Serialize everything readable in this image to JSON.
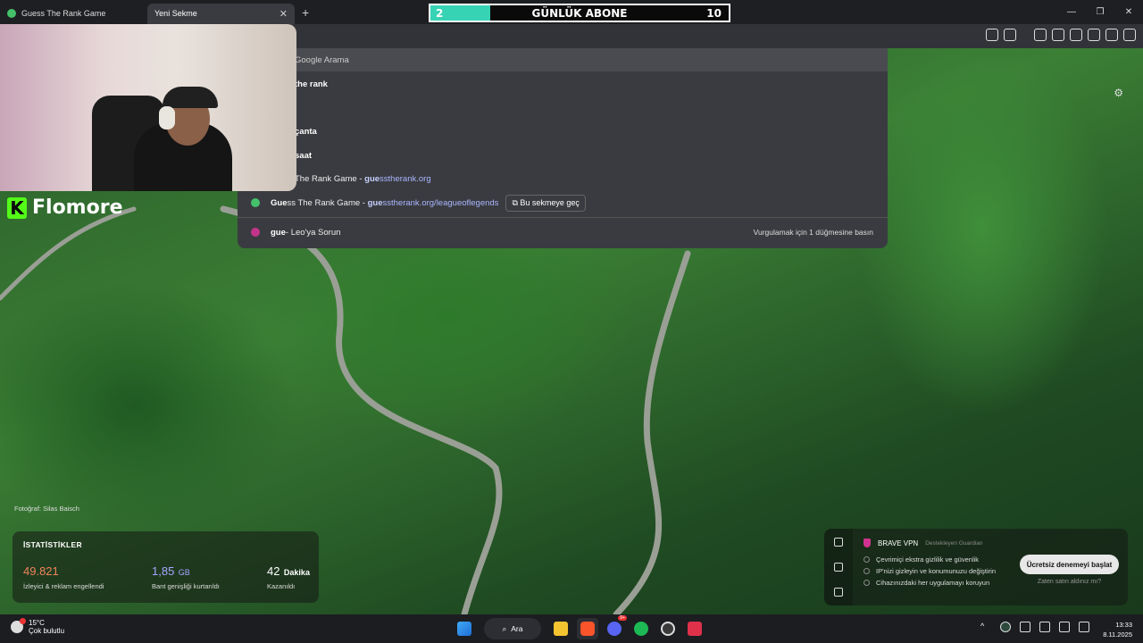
{
  "tabs": [
    {
      "label": "Guess The Rank Game",
      "active": false
    },
    {
      "label": "Yeni Sekme",
      "active": true
    }
  ],
  "subscriber_goal": {
    "title": "GÜNLÜK ABONE",
    "current": "2",
    "target": "10",
    "progress": 0.2,
    "bar_color": "#37d3b5"
  },
  "streamer_brand": {
    "name": "Flomore",
    "logo_letter": "K",
    "logo_color": "#53fc18"
  },
  "omnibox": {
    "suggestions": [
      {
        "text": "Google Arama",
        "type": "search",
        "highlighted": true
      },
      {
        "text_bold": "the rank"
      },
      {
        "text_bold": "çanta"
      },
      {
        "text_bold": "saat"
      },
      {
        "title": "The Rank Game",
        "url_bold": "gue",
        "url_rest": "sstherank.org"
      },
      {
        "title_bold": "Gue",
        "title_rest": "ss The Rank Game",
        "url_bold": "gue",
        "url_rest": "sstherank.org/leagueoflegends",
        "switch_label": "Bu sekmeye geç"
      },
      {
        "query": "gue",
        "suffix": " - Leo'ya Sorun",
        "hint": "Vurgulamak için 1 düğmesine basın"
      }
    ]
  },
  "photo_credit": "Fotoğraf: Silas Baisch",
  "stats": {
    "title": "İSTATİSTİKLER",
    "items": [
      {
        "value": "49.821",
        "unit": "",
        "label": "İzleyici & reklam engellendi",
        "color": "#f0855a"
      },
      {
        "value": "1,85",
        "unit": "GB",
        "label": "Bant genişliği kurtarıldı",
        "color": "#a7a6ff"
      },
      {
        "value": "42",
        "unit": "Dakika",
        "label": "Kazanıldı",
        "color": "#ffffff"
      }
    ]
  },
  "vpn": {
    "title": "BRAVE VPN",
    "supported_by": "Destekleyen  Guardian",
    "features": [
      "Çevrimiçi ekstra gizlilik ve güvenlik",
      "IP'nizi gizleyin ve konumunuzu değiştirin",
      "Cihazınızdaki her uygulamayı koruyun"
    ],
    "cta": "Ücretsiz denemeyi başlat",
    "already_purchased": "Zaten satın aldınız mı?"
  },
  "taskbar": {
    "weather_temp": "15°C",
    "weather_desc": "Çok bulutlu",
    "search_label": "Ara",
    "discord_badge": "9+",
    "time": "13:33",
    "date": "8.11.2025"
  }
}
